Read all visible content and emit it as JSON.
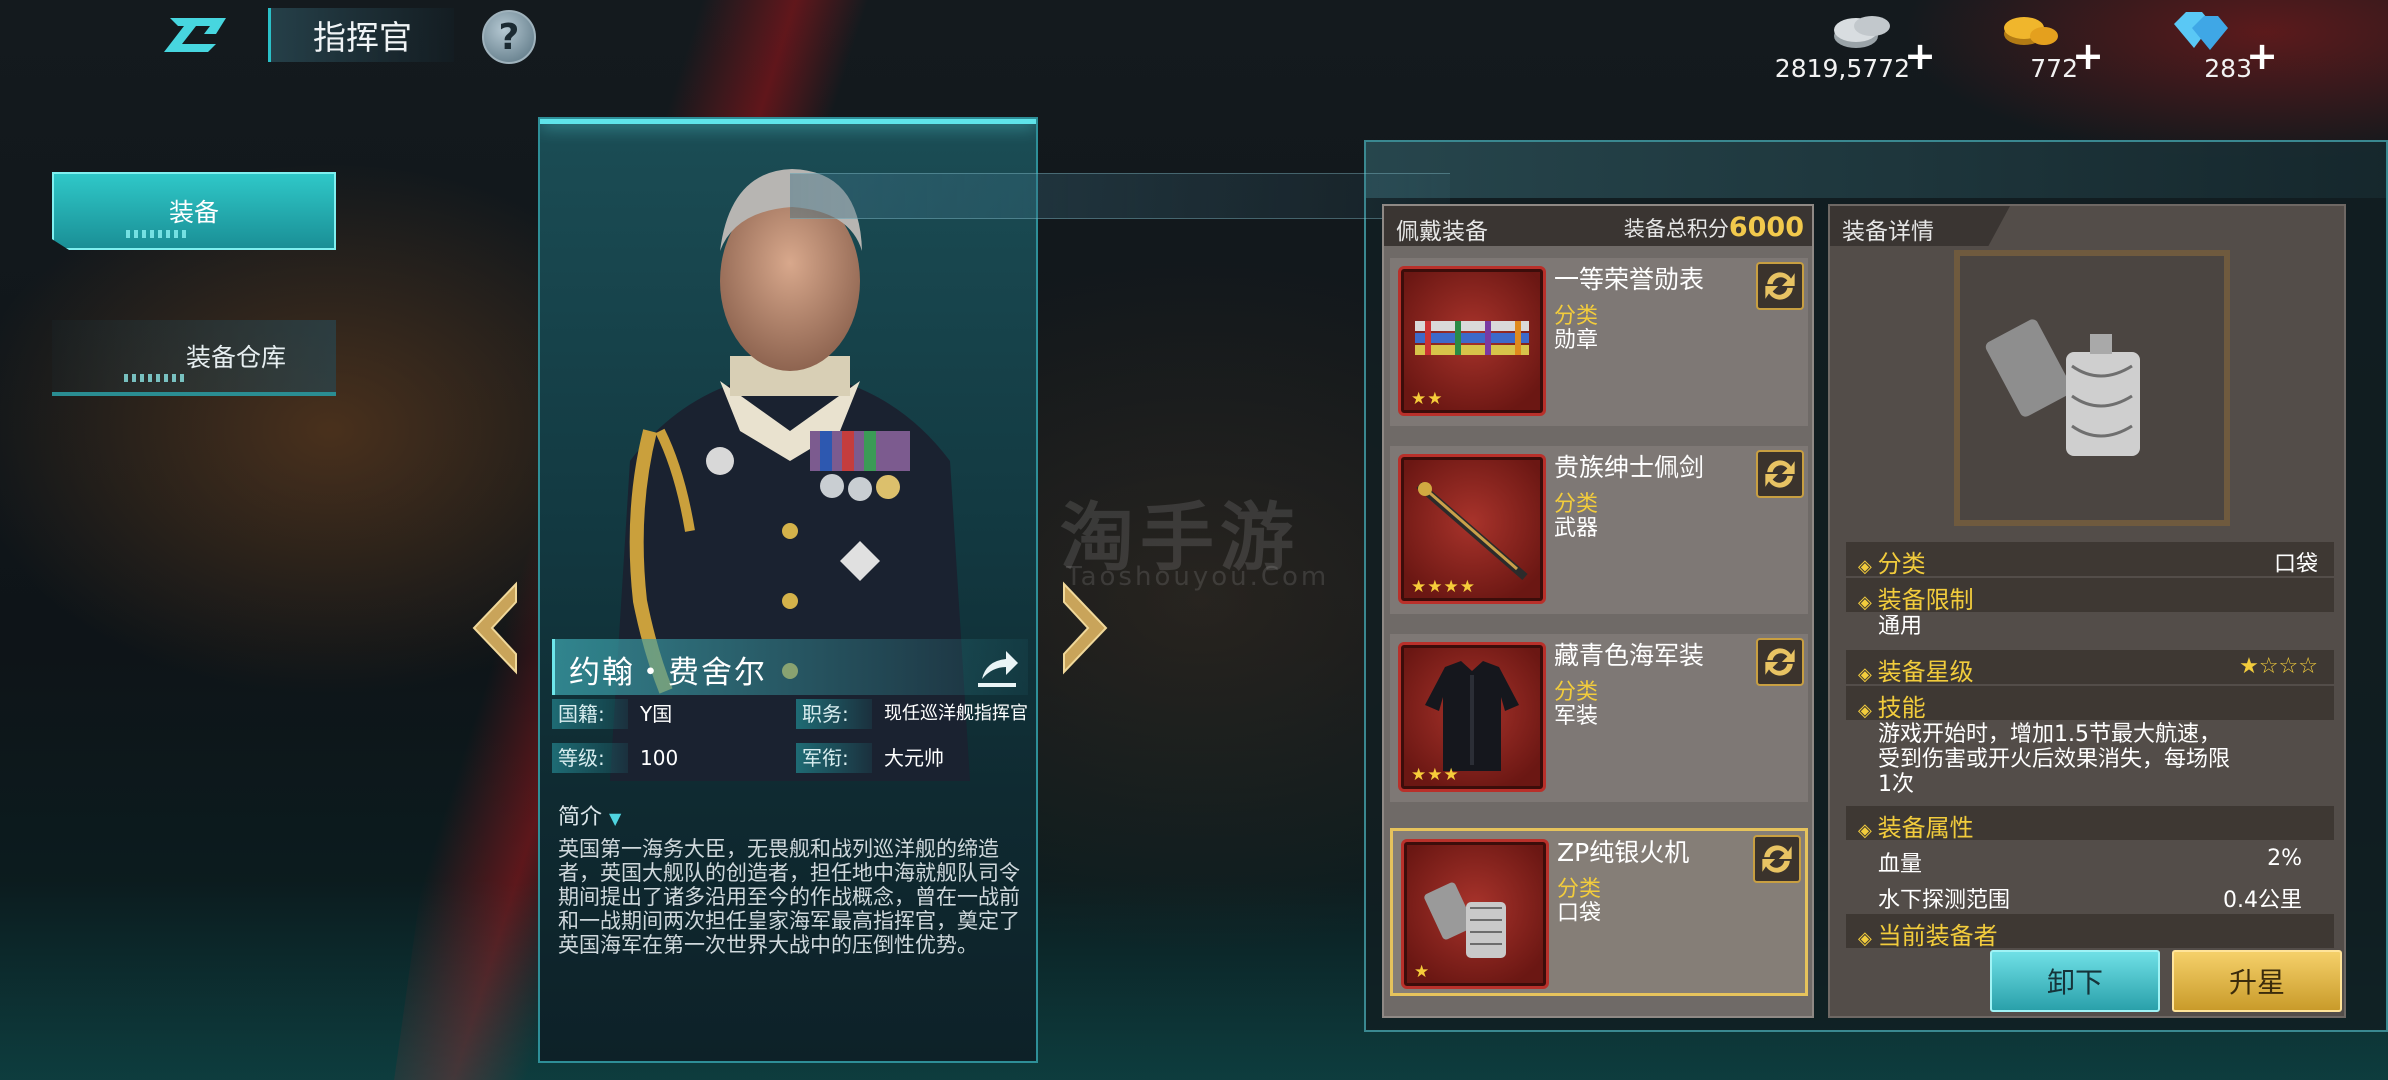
{
  "header": {
    "title": "指挥官",
    "help_icon": "question-icon",
    "resources": [
      {
        "icon": "silver-coins-icon",
        "value": "2819,5772"
      },
      {
        "icon": "gold-coins-icon",
        "value": "772"
      },
      {
        "icon": "diamond-icon",
        "value": "283"
      }
    ],
    "plus": "+"
  },
  "sidebar": {
    "items": [
      {
        "label": "装备",
        "active": true
      },
      {
        "label": "装备仓库",
        "active": false
      }
    ]
  },
  "commander": {
    "name": "约翰・费舍尔",
    "nationality_label": "国籍:",
    "nationality": "Y国",
    "post_label": "职务:",
    "post": "现任巡洋舰指挥官",
    "level_label": "等级:",
    "level": "100",
    "rank_label": "军衔:",
    "rank": "大元帅",
    "intro_title": "简介",
    "intro": "英国第一海务大臣，无畏舰和战列巡洋舰的缔造者，英国大舰队的创造者，担任地中海就舰队司令期间提出了诸多沿用至今的作战概念，曾在一战前和一战期间两次担任皇家海军最高指挥官，奠定了英国海军在第一次世界大战中的压倒性优势。"
  },
  "equipment": {
    "header_label": "佩戴装备",
    "score_label": "装备总积分",
    "score": "6000",
    "category_label": "分类",
    "slots": [
      {
        "name": "一等荣誉勋表",
        "category": "勋章",
        "stars": "★★",
        "icon": "medal-ribbons-icon"
      },
      {
        "name": "贵族绅士佩剑",
        "category": "武器",
        "stars": "★★★★",
        "icon": "sword-icon"
      },
      {
        "name": "藏青色海军装",
        "category": "军装",
        "stars": "★★★",
        "icon": "uniform-icon"
      },
      {
        "name": "ZP纯银火机",
        "category": "口袋",
        "stars": "★",
        "icon": "lighter-icon"
      }
    ]
  },
  "detail": {
    "header": "装备详情",
    "category_key": "分类",
    "category_val": "口袋",
    "limit_key": "装备限制",
    "limit_val": "通用",
    "star_key": "装备星级",
    "star_val": "★☆☆☆",
    "skill_key": "技能",
    "skill_text_1": "游戏开始时，增加1.5节最大航速，",
    "skill_text_2": "受到伤害或开火后效果消失，每场限",
    "skill_text_3": "1次",
    "attr_key": "装备属性",
    "attrs": [
      {
        "name": "血量",
        "value": "2%"
      },
      {
        "name": "水下探测范围",
        "value": "0.4公里"
      }
    ],
    "owner_key": "当前装备者",
    "remove_btn": "卸下",
    "upgrade_btn": "升星"
  },
  "watermark": {
    "cn": "淘手游",
    "en": "Taoshouyou.Com"
  }
}
